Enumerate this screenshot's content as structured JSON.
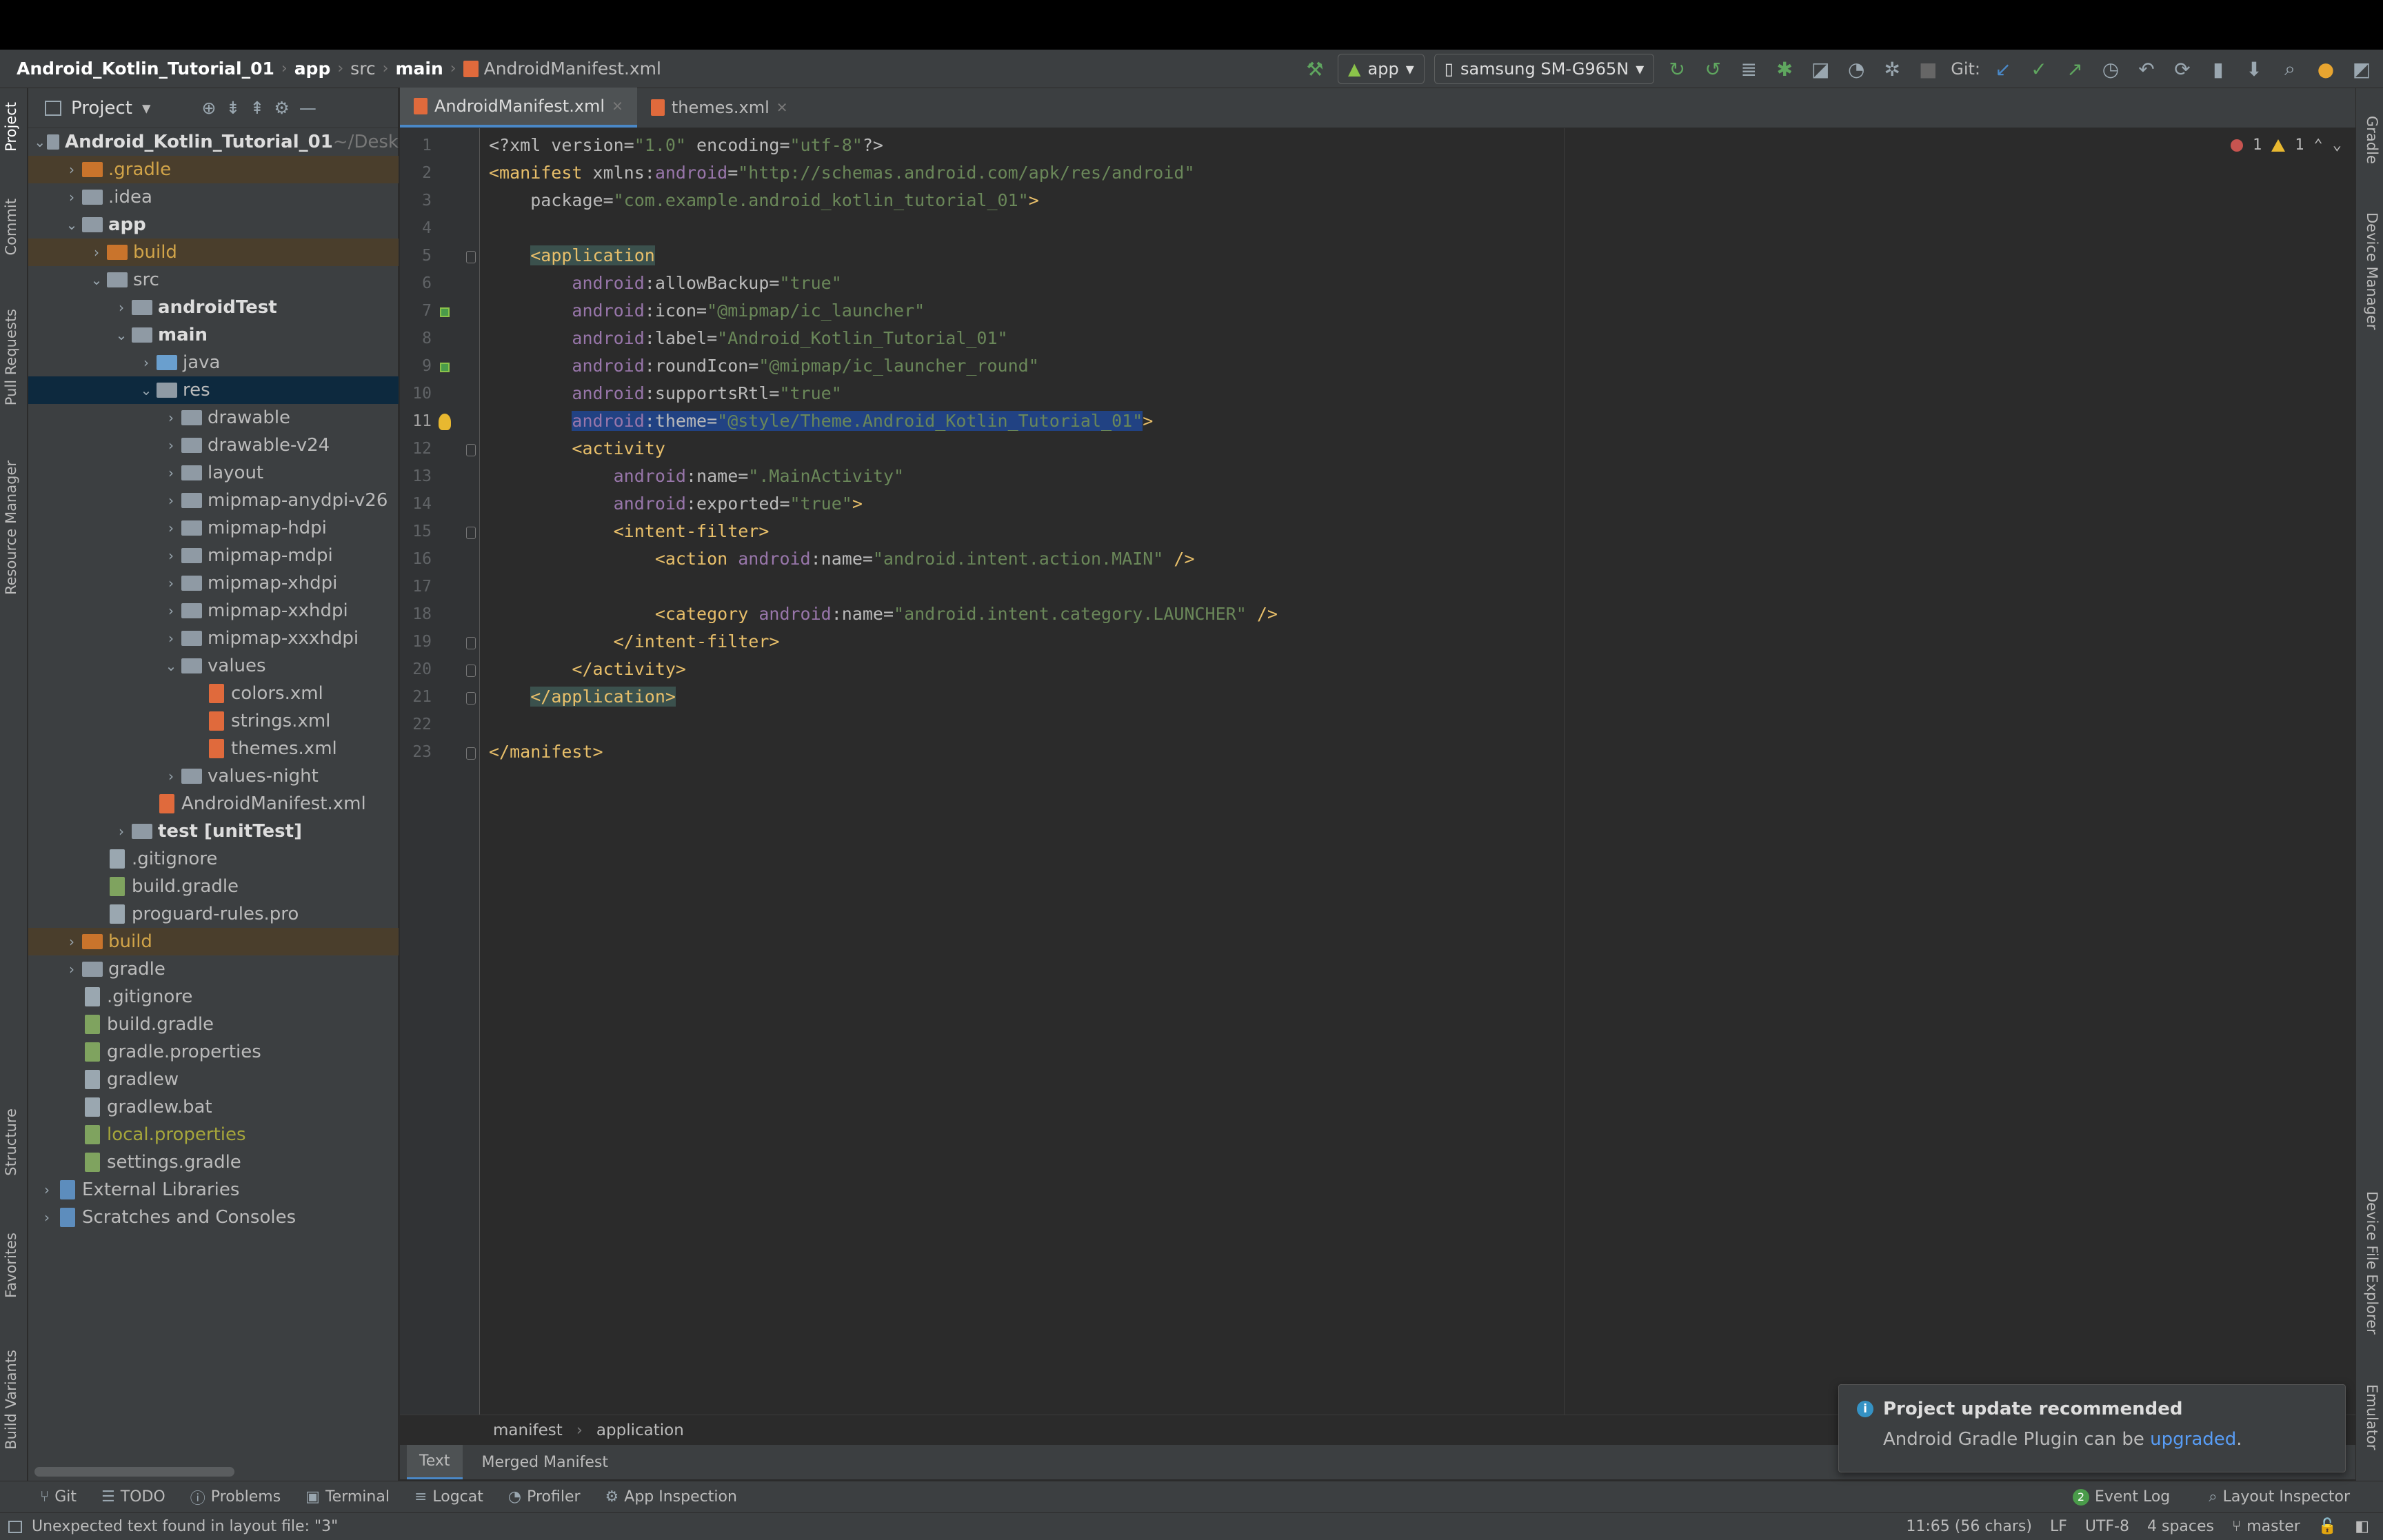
{
  "breadcrumb": {
    "project": "Android_Kotlin_Tutorial_01",
    "parts": [
      "app",
      "src",
      "main"
    ],
    "file": "AndroidManifest.xml"
  },
  "toolbar": {
    "run_config": "app",
    "device": "samsung SM-G965N",
    "git_label": "Git:"
  },
  "left_tools": [
    "Project",
    "Commit",
    "Pull Requests",
    "Resource Manager",
    "Structure",
    "Favorites",
    "Build Variants"
  ],
  "right_tools": [
    "Gradle",
    "Device Manager",
    "Device File Explorer",
    "Emulator"
  ],
  "project_panel": {
    "title": "Project",
    "tree": [
      {
        "label": "Android_Kotlin_Tutorial_01",
        "suffix": "~/Desk",
        "depth": 0,
        "arrow": "v",
        "kind": "module",
        "bold": true
      },
      {
        "label": ".gradle",
        "depth": 1,
        "arrow": ">",
        "kind": "folder-orange",
        "color": "orange",
        "hl": true
      },
      {
        "label": ".idea",
        "depth": 1,
        "arrow": ">",
        "kind": "folder"
      },
      {
        "label": "app",
        "depth": 1,
        "arrow": "v",
        "kind": "module",
        "bold": true
      },
      {
        "label": "build",
        "depth": 2,
        "arrow": ">",
        "kind": "folder-orange",
        "color": "orange",
        "hl": true
      },
      {
        "label": "src",
        "depth": 2,
        "arrow": "v",
        "kind": "folder"
      },
      {
        "label": "androidTest",
        "depth": 3,
        "arrow": ">",
        "kind": "module",
        "bold": true
      },
      {
        "label": "main",
        "depth": 3,
        "arrow": "v",
        "kind": "module",
        "bold": true
      },
      {
        "label": "java",
        "depth": 4,
        "arrow": ">",
        "kind": "folder-blue"
      },
      {
        "label": "res",
        "depth": 4,
        "arrow": "v",
        "kind": "folder",
        "sel": true
      },
      {
        "label": "drawable",
        "depth": 5,
        "arrow": ">",
        "kind": "folder"
      },
      {
        "label": "drawable-v24",
        "depth": 5,
        "arrow": ">",
        "kind": "folder"
      },
      {
        "label": "layout",
        "depth": 5,
        "arrow": ">",
        "kind": "folder"
      },
      {
        "label": "mipmap-anydpi-v26",
        "depth": 5,
        "arrow": ">",
        "kind": "folder"
      },
      {
        "label": "mipmap-hdpi",
        "depth": 5,
        "arrow": ">",
        "kind": "folder"
      },
      {
        "label": "mipmap-mdpi",
        "depth": 5,
        "arrow": ">",
        "kind": "folder"
      },
      {
        "label": "mipmap-xhdpi",
        "depth": 5,
        "arrow": ">",
        "kind": "folder"
      },
      {
        "label": "mipmap-xxhdpi",
        "depth": 5,
        "arrow": ">",
        "kind": "folder"
      },
      {
        "label": "mipmap-xxxhdpi",
        "depth": 5,
        "arrow": ">",
        "kind": "folder"
      },
      {
        "label": "values",
        "depth": 5,
        "arrow": "v",
        "kind": "folder"
      },
      {
        "label": "colors.xml",
        "depth": 6,
        "arrow": "",
        "kind": "xml"
      },
      {
        "label": "strings.xml",
        "depth": 6,
        "arrow": "",
        "kind": "xml"
      },
      {
        "label": "themes.xml",
        "depth": 6,
        "arrow": "",
        "kind": "xml"
      },
      {
        "label": "values-night",
        "depth": 5,
        "arrow": ">",
        "kind": "folder"
      },
      {
        "label": "AndroidManifest.xml",
        "depth": 4,
        "arrow": "",
        "kind": "xml"
      },
      {
        "label": "test [unitTest]",
        "depth": 3,
        "arrow": ">",
        "kind": "module",
        "bold": true
      },
      {
        "label": ".gitignore",
        "depth": 2,
        "arrow": "",
        "kind": "file"
      },
      {
        "label": "build.gradle",
        "depth": 2,
        "arrow": "",
        "kind": "gradle"
      },
      {
        "label": "proguard-rules.pro",
        "depth": 2,
        "arrow": "",
        "kind": "file"
      },
      {
        "label": "build",
        "depth": 1,
        "arrow": ">",
        "kind": "folder-orange",
        "color": "orange",
        "hl": true
      },
      {
        "label": "gradle",
        "depth": 1,
        "arrow": ">",
        "kind": "folder"
      },
      {
        "label": ".gitignore",
        "depth": 1,
        "arrow": "",
        "kind": "file"
      },
      {
        "label": "build.gradle",
        "depth": 1,
        "arrow": "",
        "kind": "gradle"
      },
      {
        "label": "gradle.properties",
        "depth": 1,
        "arrow": "",
        "kind": "gradle"
      },
      {
        "label": "gradlew",
        "depth": 1,
        "arrow": "",
        "kind": "file"
      },
      {
        "label": "gradlew.bat",
        "depth": 1,
        "arrow": "",
        "kind": "file"
      },
      {
        "label": "local.properties",
        "depth": 1,
        "arrow": "",
        "kind": "gradle",
        "color": "olive"
      },
      {
        "label": "settings.gradle",
        "depth": 1,
        "arrow": "",
        "kind": "gradle"
      },
      {
        "label": "External Libraries",
        "depth": 0,
        "arrow": ">",
        "kind": "lib"
      },
      {
        "label": "Scratches and Consoles",
        "depth": 0,
        "arrow": ">",
        "kind": "lib"
      }
    ]
  },
  "editor": {
    "tabs": [
      {
        "label": "AndroidManifest.xml",
        "active": true
      },
      {
        "label": "themes.xml",
        "active": false
      }
    ],
    "error_count": "1",
    "warning_count": "1",
    "current_line": 11,
    "lines": [
      [
        [
          "t",
          "<?xml version="
        ],
        [
          "v",
          "\"1.0\""
        ],
        [
          "t",
          " encoding="
        ],
        [
          "v",
          "\"utf-8\""
        ],
        [
          "t",
          "?>"
        ]
      ],
      [
        [
          "g",
          "<manifest "
        ],
        [
          "a",
          "xmlns:"
        ],
        [
          "n",
          "android"
        ],
        [
          "a",
          "="
        ],
        [
          "v",
          "\"http://schemas.android.com/apk/res/android\""
        ]
      ],
      [
        [
          "a",
          "    package="
        ],
        [
          "v",
          "\"com.example.android_kotlin_tutorial_01\""
        ],
        [
          "g",
          ">"
        ]
      ],
      [],
      [
        [
          "a",
          "    "
        ],
        [
          "gb",
          "<application"
        ]
      ],
      [
        [
          "a",
          "        "
        ],
        [
          "n",
          "android"
        ],
        [
          "a",
          ":allowBackup="
        ],
        [
          "v",
          "\"true\""
        ]
      ],
      [
        [
          "a",
          "        "
        ],
        [
          "n",
          "android"
        ],
        [
          "a",
          ":icon="
        ],
        [
          "v",
          "\"@mipmap/ic_launcher\""
        ]
      ],
      [
        [
          "a",
          "        "
        ],
        [
          "n",
          "android"
        ],
        [
          "a",
          ":label="
        ],
        [
          "v",
          "\"Android_Kotlin_Tutorial_01\""
        ]
      ],
      [
        [
          "a",
          "        "
        ],
        [
          "n",
          "android"
        ],
        [
          "a",
          ":roundIcon="
        ],
        [
          "v",
          "\"@mipmap/ic_launcher_round\""
        ]
      ],
      [
        [
          "a",
          "        "
        ],
        [
          "n",
          "android"
        ],
        [
          "a",
          ":supportsRtl="
        ],
        [
          "v",
          "\"true\""
        ]
      ],
      [
        [
          "a",
          "        "
        ],
        [
          "sn",
          "android"
        ],
        [
          "sa",
          ":theme="
        ],
        [
          "sv",
          "\"@style/Theme.Android_Kotlin_Tutorial_01\""
        ],
        [
          "g",
          ">"
        ]
      ],
      [
        [
          "a",
          "        "
        ],
        [
          "g",
          "<activity"
        ]
      ],
      [
        [
          "a",
          "            "
        ],
        [
          "n",
          "android"
        ],
        [
          "a",
          ":name="
        ],
        [
          "v",
          "\".MainActivity\""
        ]
      ],
      [
        [
          "a",
          "            "
        ],
        [
          "n",
          "android"
        ],
        [
          "a",
          ":exported="
        ],
        [
          "v",
          "\"true\""
        ],
        [
          "g",
          ">"
        ]
      ],
      [
        [
          "a",
          "            "
        ],
        [
          "g",
          "<intent-filter>"
        ]
      ],
      [
        [
          "a",
          "                "
        ],
        [
          "g",
          "<action "
        ],
        [
          "n",
          "android"
        ],
        [
          "a",
          ":name="
        ],
        [
          "v",
          "\"android.intent.action.MAIN\""
        ],
        [
          "g",
          " />"
        ]
      ],
      [],
      [
        [
          "a",
          "                "
        ],
        [
          "g",
          "<category "
        ],
        [
          "n",
          "android"
        ],
        [
          "a",
          ":name="
        ],
        [
          "v",
          "\"android.intent.category.LAUNCHER\""
        ],
        [
          "g",
          " />"
        ]
      ],
      [
        [
          "a",
          "            "
        ],
        [
          "g",
          "</intent-filter>"
        ]
      ],
      [
        [
          "a",
          "        "
        ],
        [
          "g",
          "</activity>"
        ]
      ],
      [
        [
          "a",
          "    "
        ],
        [
          "gb",
          "</application>"
        ]
      ],
      [],
      [
        [
          "g",
          "</manifest>"
        ]
      ]
    ],
    "breadcrumb": [
      "manifest",
      "application"
    ],
    "bottom_tabs": [
      {
        "label": "Text",
        "active": true
      },
      {
        "label": "Merged Manifest",
        "active": false
      }
    ]
  },
  "tool_windows": [
    {
      "label": "Git",
      "icon": "⑂"
    },
    {
      "label": "TODO",
      "icon": "☰"
    },
    {
      "label": "Problems",
      "icon": "ⓘ"
    },
    {
      "label": "Terminal",
      "icon": "▣"
    },
    {
      "label": "Logcat",
      "icon": "≡"
    },
    {
      "label": "Profiler",
      "icon": "◔"
    },
    {
      "label": "App Inspection",
      "icon": "⚙"
    }
  ],
  "tool_windows_right": [
    {
      "label": "Event Log",
      "badge": "2"
    },
    {
      "label": "Layout Inspector"
    }
  ],
  "status": {
    "message": "Unexpected text found in layout file: \"3\"",
    "position": "11:65 (56 chars)",
    "line_sep": "LF",
    "encoding": "UTF-8",
    "indent": "4 spaces",
    "branch": "master"
  },
  "notification": {
    "title": "Project update recommended",
    "body_prefix": "Android Gradle Plugin can be ",
    "link": "upgraded",
    "body_suffix": "."
  }
}
